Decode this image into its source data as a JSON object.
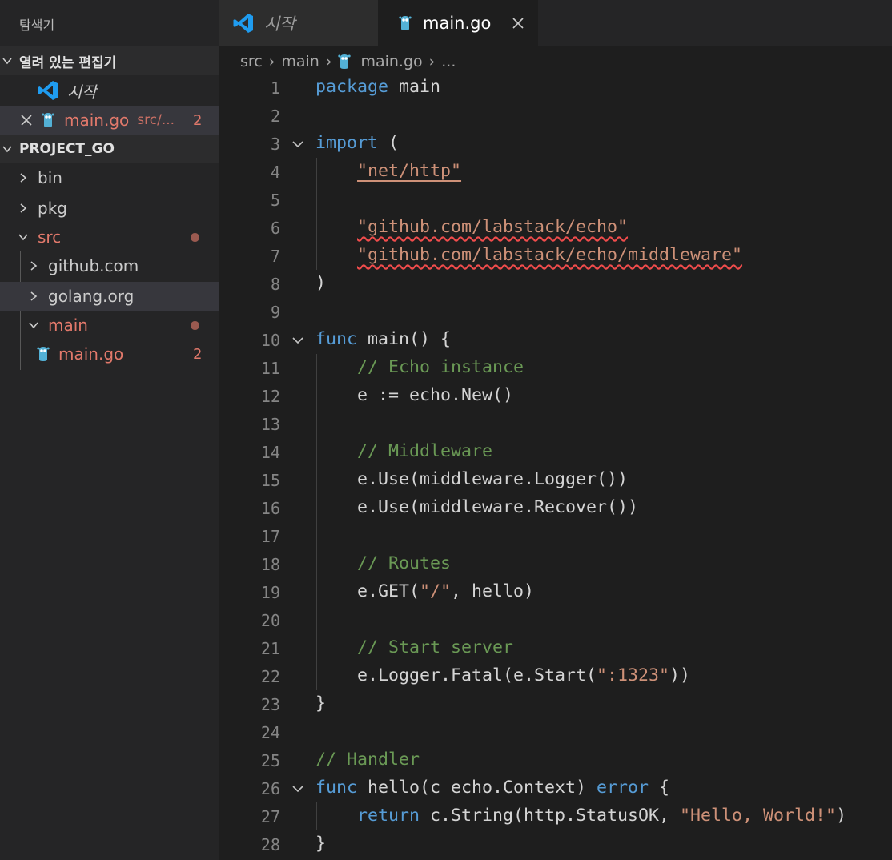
{
  "explorer": {
    "title": "탐색기",
    "open_editors": {
      "label": "열려 있는 편집기",
      "items": [
        {
          "name": "시작"
        },
        {
          "name": "main.go",
          "path": "src/...",
          "badge": "2"
        }
      ]
    },
    "project": {
      "label": "PROJECT_GO",
      "tree": [
        {
          "name": "bin"
        },
        {
          "name": "pkg"
        },
        {
          "name": "src"
        },
        {
          "name": "github.com"
        },
        {
          "name": "golang.org"
        },
        {
          "name": "main"
        },
        {
          "name": "main.go",
          "badge": "2"
        }
      ]
    }
  },
  "tabs": [
    {
      "label": "시작"
    },
    {
      "label": "main.go"
    }
  ],
  "breadcrumb": [
    "src",
    "main",
    "main.go",
    "..."
  ],
  "code": {
    "lines": [
      "package main",
      "",
      "import (",
      "    \"net/http\"",
      "",
      "    \"github.com/labstack/echo\"",
      "    \"github.com/labstack/echo/middleware\"",
      ")",
      "",
      "func main() {",
      "    // Echo instance",
      "    e := echo.New()",
      "",
      "    // Middleware",
      "    e.Use(middleware.Logger())",
      "    e.Use(middleware.Recover())",
      "",
      "    // Routes",
      "    e.GET(\"/\", hello)",
      "",
      "    // Start server",
      "    e.Logger.Fatal(e.Start(\":1323\"))",
      "}",
      "",
      "// Handler",
      "func hello(c echo.Context) error {",
      "    return c.String(http.StatusOK, \"Hello, World!\")",
      "}"
    ]
  },
  "colors": {
    "keyword": "#569cd6",
    "string": "#ce9178",
    "comment": "#6a9955",
    "error": "#e2796b"
  },
  "icons": [
    "vscode-icon",
    "gopher-icon",
    "close-icon",
    "chevron-right-icon",
    "chevron-down-icon"
  ]
}
